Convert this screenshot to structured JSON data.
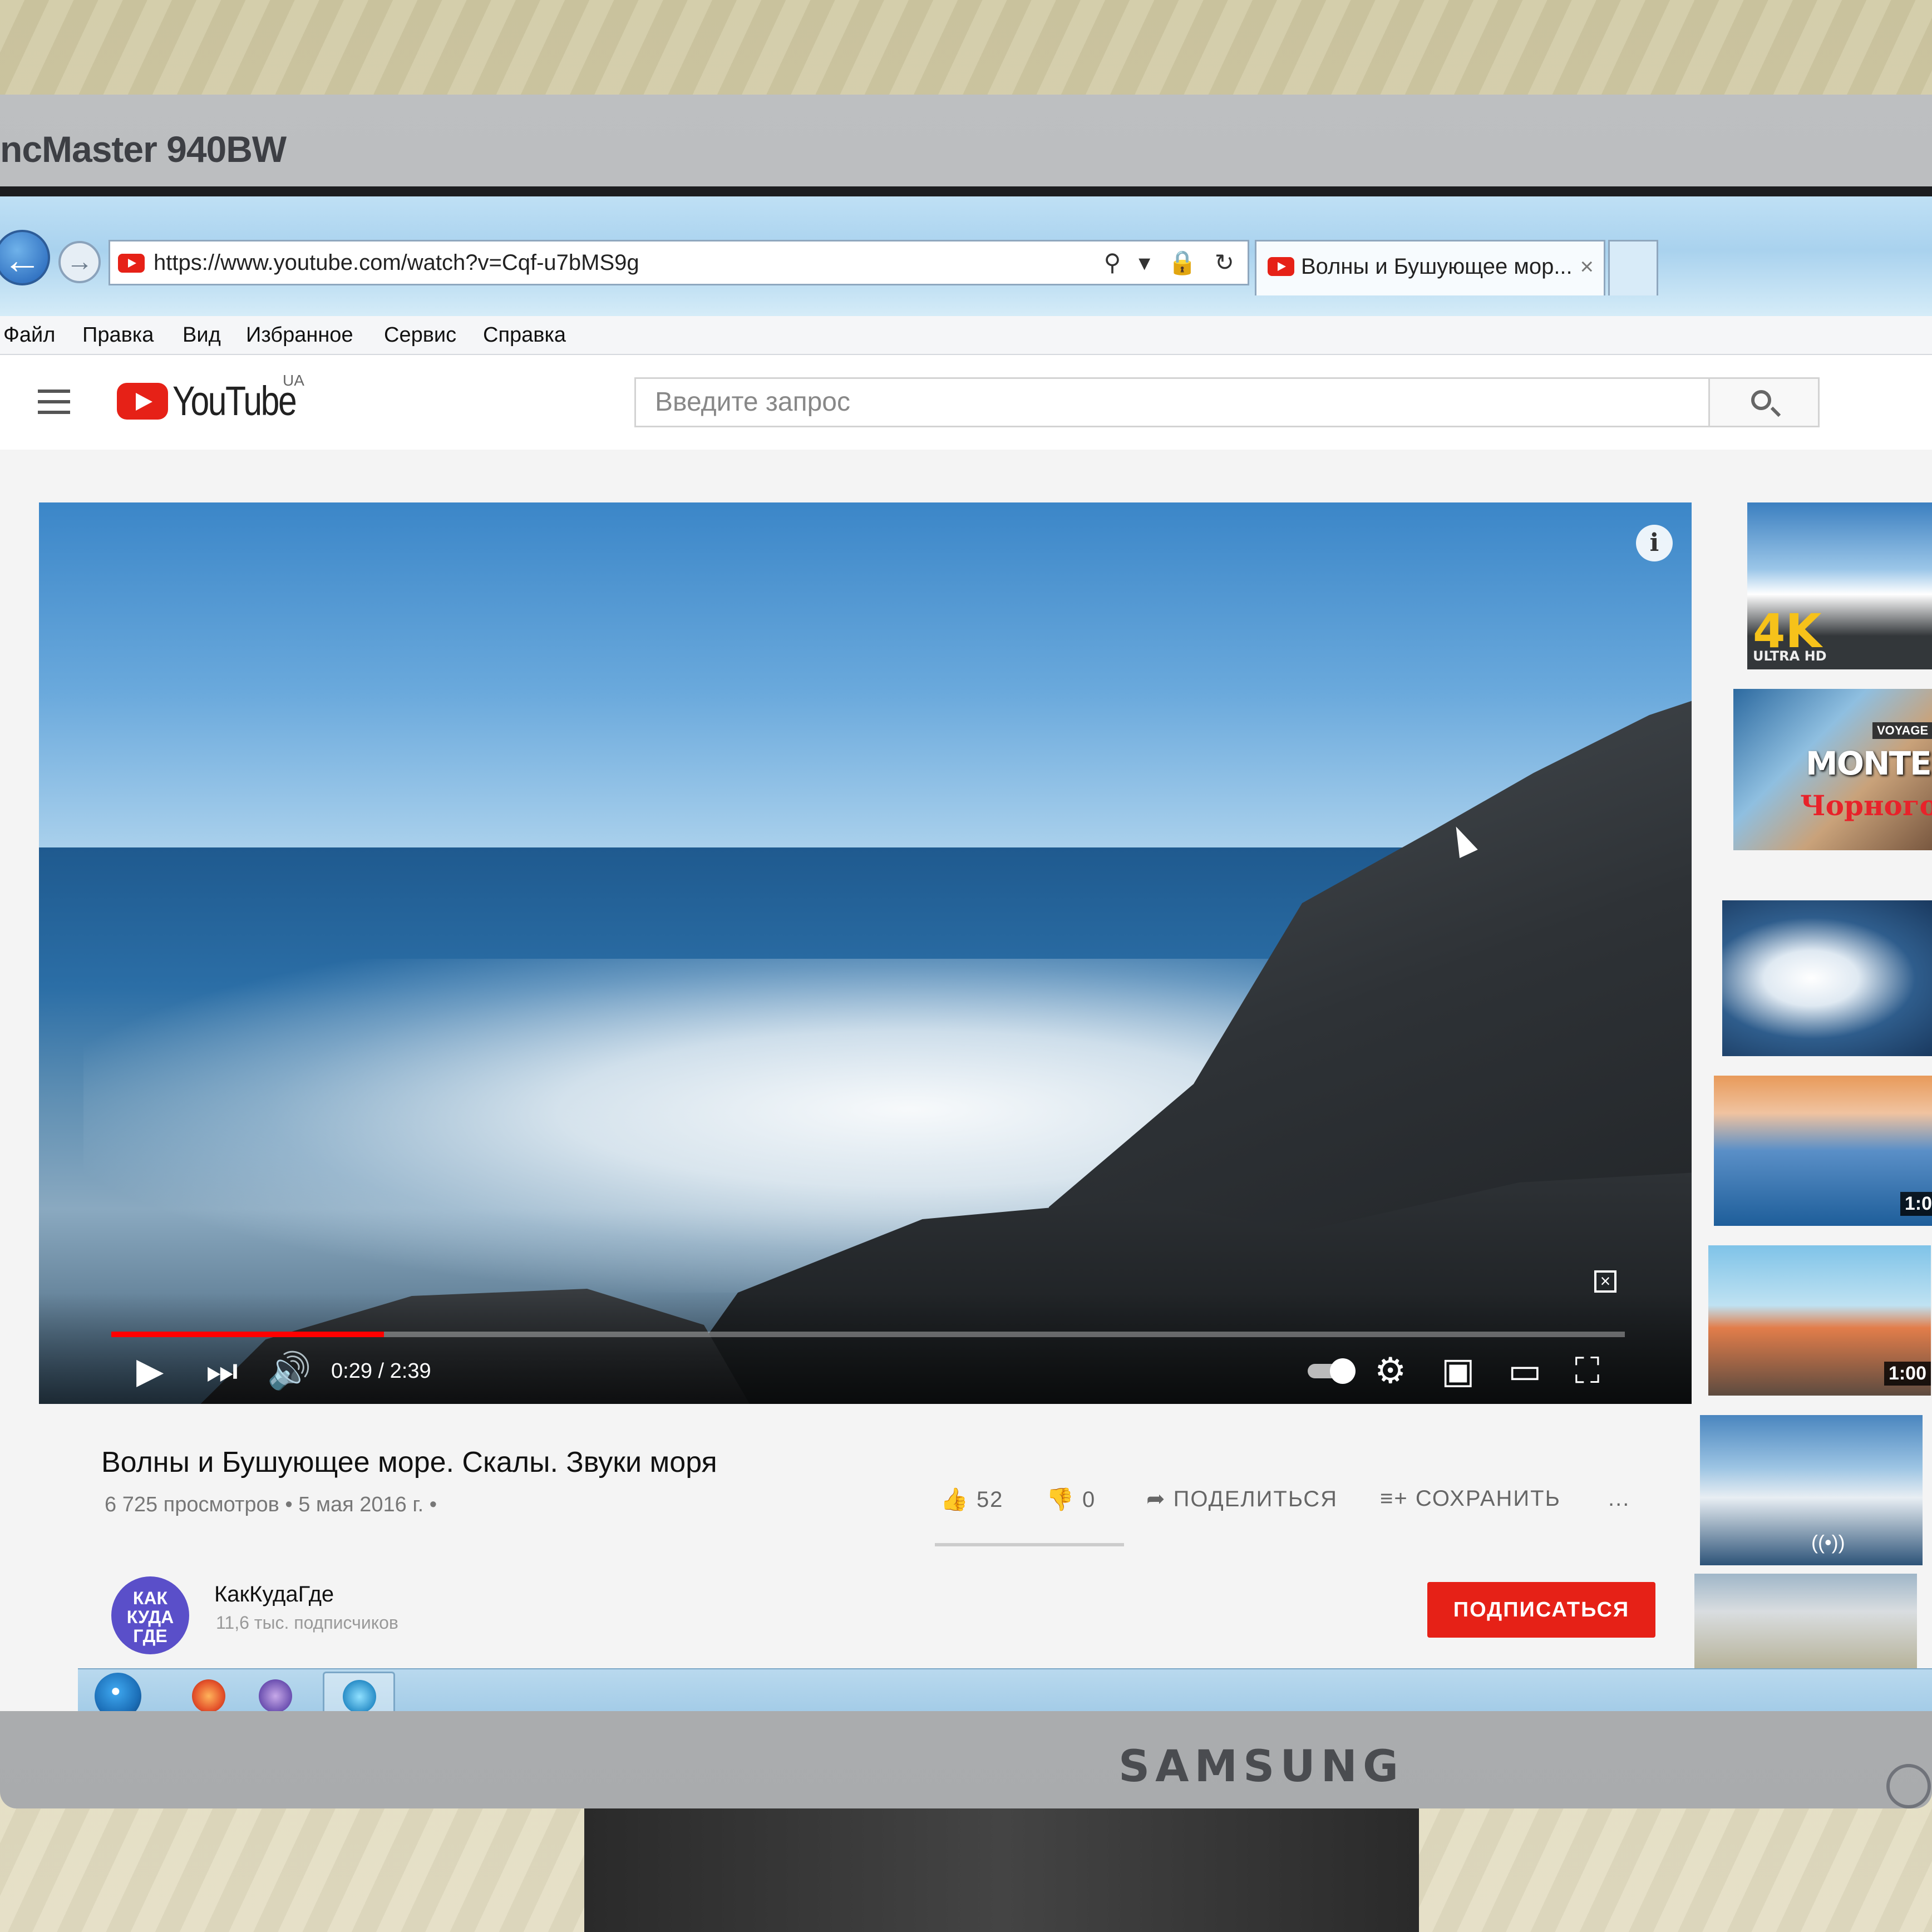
{
  "monitor": {
    "model": "ncMaster 940BW",
    "brand": "SAMSUNG"
  },
  "browser": {
    "url": "https://www.youtube.com/watch?v=Cqf-u7bMS9g",
    "address_icons": "⚲ ▾ 🔒 ↻",
    "tab_title": "Волны и Бушующее мор...",
    "tab_close": "×",
    "menu": [
      "Файл",
      "Правка",
      "Вид",
      "Избранное",
      "Сервис",
      "Справка"
    ]
  },
  "youtube": {
    "logo_text": "YouTube",
    "country": "UA",
    "search_placeholder": "Введите запрос"
  },
  "player": {
    "current_time": "0:29",
    "duration": "2:39",
    "time_display": "0:29 / 2:39",
    "progress_fraction": 0.18,
    "info_icon": "i"
  },
  "video": {
    "title": "Волны и Бушующее море. Скалы. Звуки моря",
    "meta": "6 725 просмотров • 5 мая 2016 г. •",
    "likes": "52",
    "dislikes": "0",
    "share_label": "ПОДЕЛИТЬСЯ",
    "save_label": "СОХРАНИТЬ",
    "more_label": "..."
  },
  "channel": {
    "name": "КакКудаГде",
    "subscribers": "11,6 тыс. подписчиков",
    "avatar_text": "КАК КУДА ГДЕ",
    "subscribe_label": "ПОДПИСАТЬСЯ"
  },
  "sidebar": {
    "thumbs": [
      {
        "badge": "4K",
        "sub": "ULTRA HD"
      },
      {
        "tag": "VOYAGE",
        "title": "MONTENE",
        "subtitle": "Чорногор"
      },
      {},
      {
        "duration": "1:0"
      },
      {
        "duration": "1:00"
      },
      {
        "live": "((•))"
      },
      {}
    ]
  },
  "colors": {
    "youtube_red": "#e62117",
    "progress_red": "#ff0000"
  }
}
